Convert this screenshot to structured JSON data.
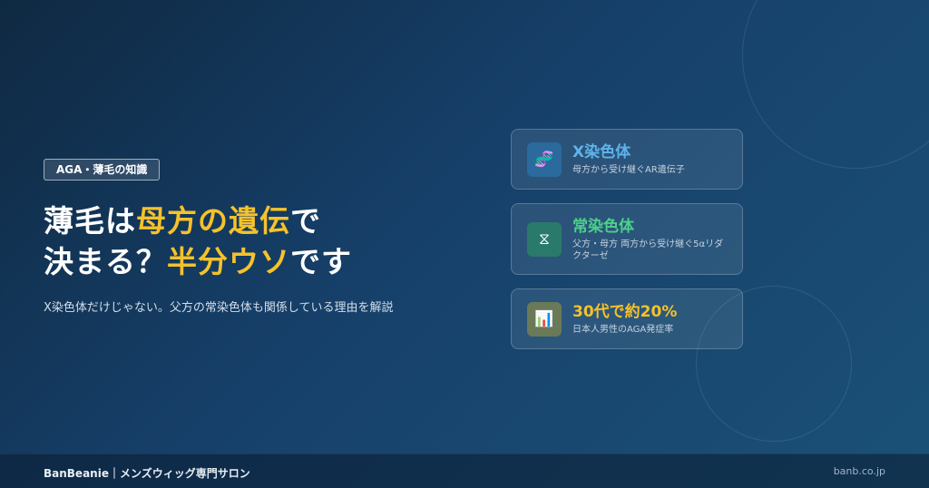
{
  "tag": "AGA・薄毛の知識",
  "headline": {
    "line1": {
      "p1": "薄毛は",
      "p2": "母方の遺伝",
      "p3": "で"
    },
    "line2": {
      "p1": "決まる？",
      "p2": "半分ウソ",
      "p3": "です"
    }
  },
  "subtext": "X染色体だけじゃない。父方の常染色体も関係している理由を解説",
  "cards": [
    {
      "icon": "dna-icon",
      "title": "X染色体",
      "desc": "母方から受け継ぐAR遺伝子",
      "title_color": "#5fb3ea",
      "icon_bg": "#2a6a9c"
    },
    {
      "icon": "chromosome-icon",
      "title": "常染色体",
      "desc": "父方・母方 両方から受け継ぐ5αリダクターゼ",
      "title_color": "#4cd08a",
      "icon_bg": "#2a7a6c"
    },
    {
      "icon": "chart-icon",
      "title": "30代で約20%",
      "desc": "日本人男性のAGA発症率",
      "title_color": "#f6c22a",
      "icon_bg": "#6a7a58"
    }
  ],
  "footer": {
    "brand": "BanBeanie｜メンズウィッグ専門サロン",
    "url": "banb.co.jp"
  },
  "colors": {
    "accent": "#f6c22a"
  }
}
